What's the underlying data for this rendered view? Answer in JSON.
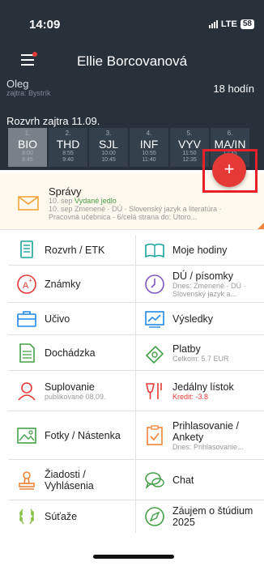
{
  "status_bar": {
    "time": "14:09",
    "network": "LTE",
    "battery": "58"
  },
  "header": {
    "title": "Ellie Borcovanová"
  },
  "account": {
    "name": "Oleg",
    "subtitle": "zajtra: Bystrík",
    "hours": "18 hodín"
  },
  "schedule": {
    "label": "Rozvrh zajtra 11.09.",
    "lessons": [
      {
        "num": "1.",
        "subject": "BIO",
        "start": "8:00",
        "end": "8:45"
      },
      {
        "num": "2.",
        "subject": "THD",
        "start": "8:55",
        "end": "9:40"
      },
      {
        "num": "3.",
        "subject": "SJL",
        "start": "10:00",
        "end": "10:45"
      },
      {
        "num": "4.",
        "subject": "INF",
        "start": "10:55",
        "end": "11:40"
      },
      {
        "num": "5.",
        "subject": "VYV",
        "start": "11:50",
        "end": "12:35"
      },
      {
        "num": "6.",
        "subject": "MA/IN",
        "start": "12:45",
        "end": "13:30"
      }
    ]
  },
  "fab": {
    "label": "+"
  },
  "messages": {
    "title": "Správy",
    "line1_date": "10. sep",
    "line1_text": "Vydané jedlo",
    "line2_date": "10. sep",
    "line2_text": "Zmenené · DÚ · Slovenský jazyk a literatúra ·",
    "line3_text": "Pracovná učebnica - 6/celá strana do: Utoro..."
  },
  "grid": [
    {
      "label": "Rozvrh / ETK",
      "sub": "",
      "icon": "timetable-icon"
    },
    {
      "label": "Moje hodiny",
      "sub": "",
      "icon": "book-icon"
    },
    {
      "label": "Známky",
      "sub": "",
      "icon": "grade-icon"
    },
    {
      "label": "DÚ / písomky",
      "sub": "Dnes: Zmenené · DÚ ·",
      "sub2": "Slovenský jazyk a...",
      "icon": "clock-icon"
    },
    {
      "label": "Učivo",
      "sub": "",
      "icon": "briefcase-icon"
    },
    {
      "label": "Výsledky",
      "sub": "",
      "icon": "results-icon"
    },
    {
      "label": "Dochádzka",
      "sub": "",
      "icon": "attendance-icon"
    },
    {
      "label": "Platby",
      "sub": "Celkom: 5.7 EUR",
      "icon": "payment-icon"
    },
    {
      "label": "Suplovanie",
      "sub": "publikované 08.09.",
      "icon": "substitution-icon"
    },
    {
      "label": "Jedálny lístok",
      "sub": "Kredit: -3.8",
      "icon": "cutlery-icon"
    },
    {
      "label": "Fotky / Nástenka",
      "sub": "",
      "icon": "photo-icon"
    },
    {
      "label": "Prihlasovanie /",
      "label2": "Ankety",
      "sub": "Dnes: Prihlasovanie...",
      "icon": "survey-icon"
    },
    {
      "label": "Žiadosti /",
      "label2": "Vyhlásenia",
      "sub": "",
      "icon": "stamp-icon"
    },
    {
      "label": "Chat",
      "sub": "",
      "icon": "chat-icon"
    },
    {
      "label": "Súťaže",
      "sub": "",
      "icon": "laurel-icon"
    },
    {
      "label": "Záujem o štúdium",
      "label2": "2025",
      "sub": "",
      "icon": "compass-icon"
    }
  ],
  "colors": {
    "dark": "#283039",
    "accent": "#1ba39c",
    "red": "#e53935",
    "green": "#43a047"
  }
}
